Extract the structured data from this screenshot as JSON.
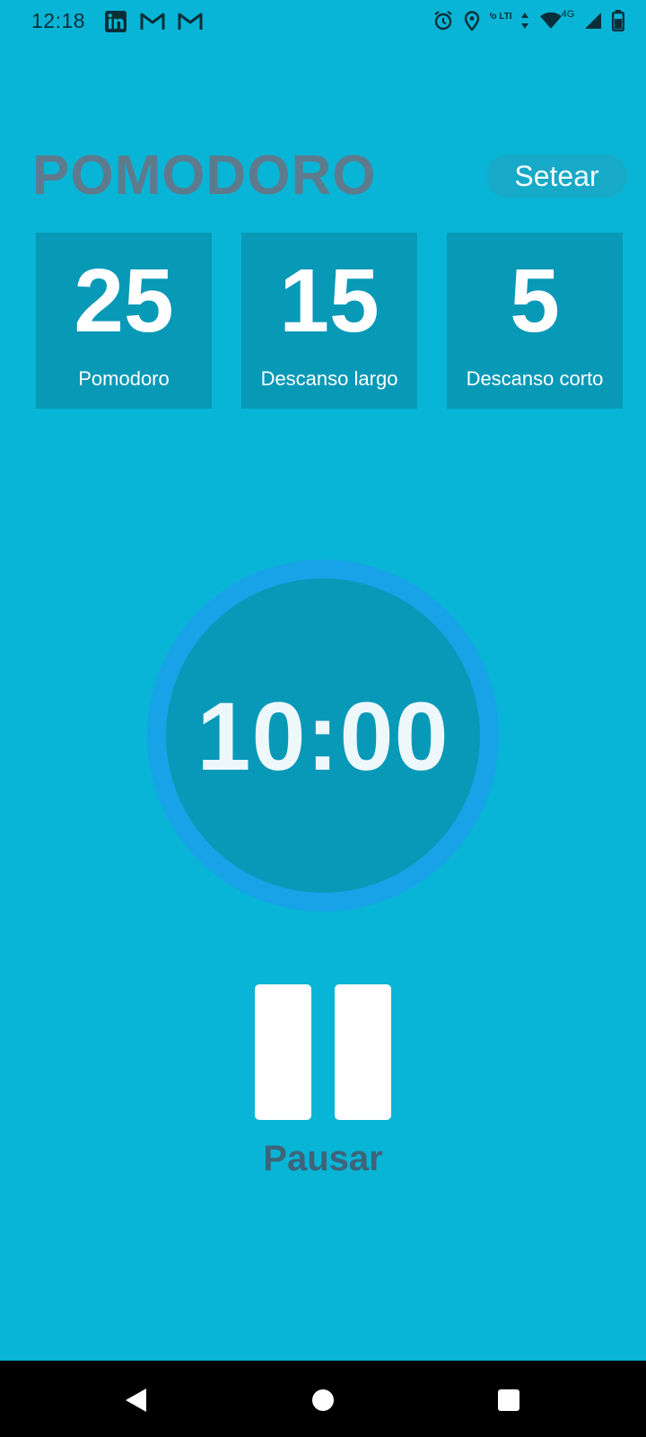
{
  "status_bar": {
    "time": "12:18",
    "left_icons": [
      "linkedin-icon",
      "gmail-icon",
      "gmail-icon"
    ],
    "right_icons": [
      "alarm-icon",
      "location-icon",
      "volte-icon",
      "data-arrows-icon",
      "wifi-icon",
      "signal-icon",
      "battery-icon"
    ],
    "volte_label": "Vo LTE",
    "network_label": "4G"
  },
  "header": {
    "title": "POMODORO",
    "set_label": "Setear"
  },
  "presets": [
    {
      "value": "25",
      "label": "Pomodoro"
    },
    {
      "value": "15",
      "label": "Descanso largo"
    },
    {
      "value": "5",
      "label": "Descanso corto"
    }
  ],
  "timer": {
    "display": "10:00"
  },
  "control": {
    "label": "Pausar",
    "icon": "pause-icon"
  },
  "colors": {
    "background": "#08b5d6",
    "card": "#0899b7",
    "ring": "#18a2e8",
    "title": "#5e7b8e",
    "pause_label": "#3e647a"
  },
  "nav": {
    "icons": [
      "back-icon",
      "home-icon",
      "recents-icon"
    ]
  }
}
